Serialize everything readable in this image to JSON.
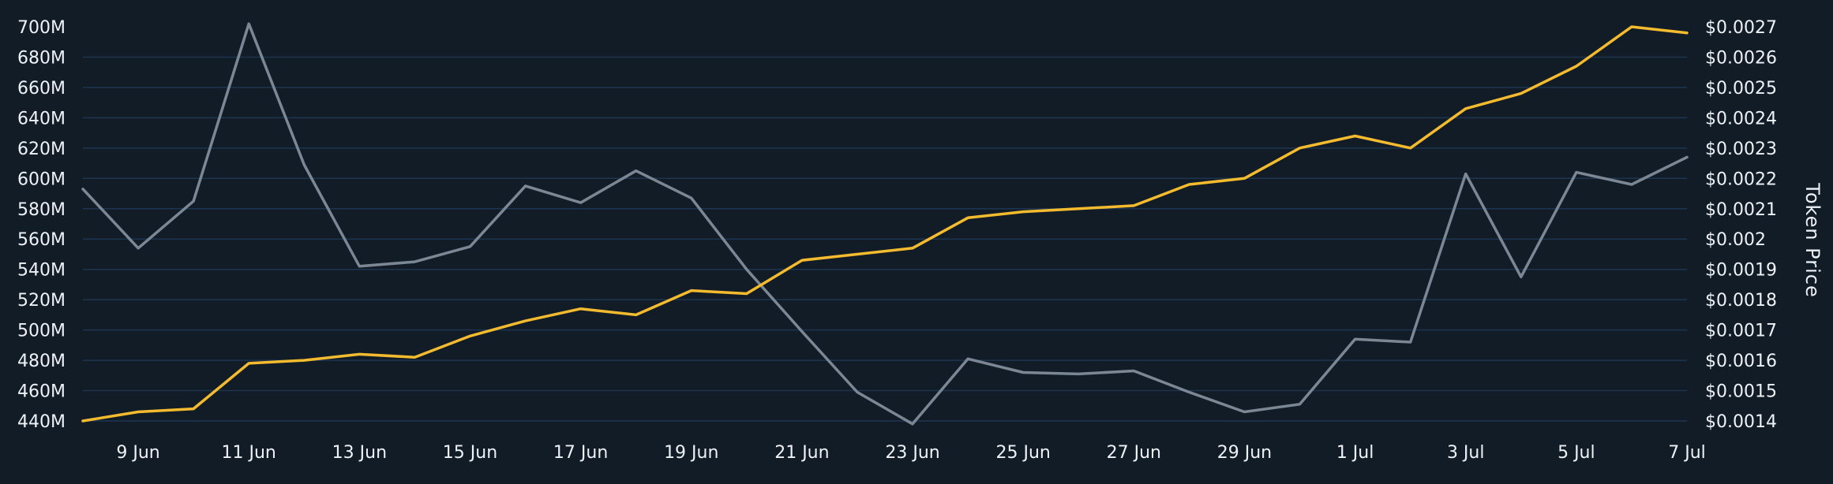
{
  "chart_data": {
    "type": "line",
    "title": "",
    "xlabel": "",
    "ylabel_left": "",
    "ylabel_right": "Token Price",
    "x": [
      "8 Jun",
      "9 Jun",
      "10 Jun",
      "11 Jun",
      "12 Jun",
      "13 Jun",
      "14 Jun",
      "15 Jun",
      "16 Jun",
      "17 Jun",
      "18 Jun",
      "19 Jun",
      "20 Jun",
      "21 Jun",
      "22 Jun",
      "23 Jun",
      "24 Jun",
      "25 Jun",
      "26 Jun",
      "27 Jun",
      "28 Jun",
      "29 Jun",
      "30 Jun",
      "1 Jul",
      "2 Jul",
      "3 Jul",
      "4 Jul",
      "5 Jul",
      "6 Jul",
      "7 Jul"
    ],
    "x_tick_labels": [
      "9 Jun",
      "11 Jun",
      "13 Jun",
      "15 Jun",
      "17 Jun",
      "19 Jun",
      "21 Jun",
      "23 Jun",
      "25 Jun",
      "27 Jun",
      "29 Jun",
      "1 Jul",
      "3 Jul",
      "5 Jul",
      "7 Jul"
    ],
    "left_axis": {
      "ylim": [
        440,
        700
      ],
      "ticks": [
        "440M",
        "460M",
        "480M",
        "500M",
        "520M",
        "540M",
        "560M",
        "580M",
        "600M",
        "620M",
        "640M",
        "660M",
        "680M",
        "700M"
      ]
    },
    "right_axis": {
      "ylim": [
        0.0014,
        0.0027
      ],
      "ticks": [
        "$0.0014",
        "$0.0015",
        "$0.0016",
        "$0.0017",
        "$0.0018",
        "$0.0019",
        "$0.002",
        "$0.0021",
        "$0.0022",
        "$0.0023",
        "$0.0024",
        "$0.0025",
        "$0.0026",
        "$0.0027"
      ]
    },
    "grid": true,
    "series": [
      {
        "axis": "left",
        "color": "#7b8794",
        "values": [
          593,
          554,
          585,
          702,
          609,
          542,
          545,
          555,
          595,
          584,
          605,
          587,
          540,
          499,
          459,
          438,
          481,
          472,
          471,
          473,
          459,
          446,
          451,
          494,
          492,
          603,
          535,
          604,
          596,
          614
        ]
      },
      {
        "axis": "right",
        "color": "#f5bb2f",
        "values": [
          0.0014,
          0.00143,
          0.00144,
          0.00159,
          0.0016,
          0.00162,
          0.00161,
          0.00168,
          0.00173,
          0.00177,
          0.00175,
          0.00183,
          0.00182,
          0.00193,
          0.00195,
          0.00197,
          0.00207,
          0.00209,
          0.0021,
          0.00211,
          0.00218,
          0.0022,
          0.0023,
          0.00234,
          0.0023,
          0.00243,
          0.00248,
          0.00257,
          0.0027,
          0.00268
        ]
      }
    ]
  }
}
